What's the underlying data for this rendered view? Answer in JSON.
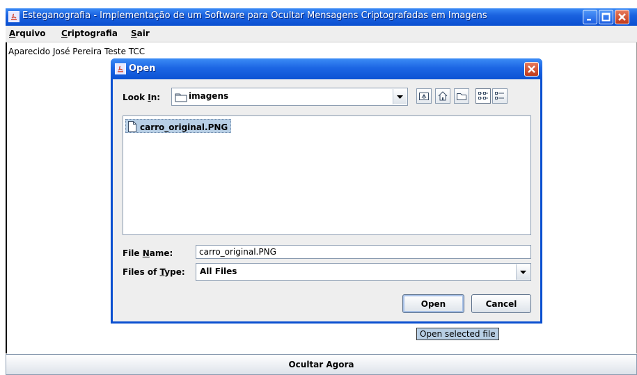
{
  "window": {
    "title": "Esteganografia - Implementação de um Software para Ocultar Mensagens Criptografadas em Imagens"
  },
  "menu": {
    "items": [
      {
        "label": "Arquivo",
        "mnemonic": "A",
        "rest": "rquivo"
      },
      {
        "label": "Criptografia",
        "mnemonic": "C",
        "rest": "riptografia"
      },
      {
        "label": "Sair",
        "mnemonic": "S",
        "rest": "air"
      }
    ]
  },
  "content": {
    "author_label": "Aparecido José Pereira Teste TCC"
  },
  "bottom_button": {
    "label": "Ocultar Agora"
  },
  "dialog": {
    "title": "Open",
    "look_in": {
      "label_pre": "Look ",
      "label_mnemonic": "I",
      "label_post": "n:",
      "value": "imagens"
    },
    "toolbar_icons": [
      "up-folder-icon",
      "home-icon",
      "new-folder-icon",
      "list-view-icon",
      "details-view-icon"
    ],
    "files": [
      {
        "name": "carro_original.PNG",
        "selected": true
      }
    ],
    "file_name": {
      "label_pre": "File ",
      "label_mnemonic": "N",
      "label_post": "ame:",
      "value": "carro_original.PNG"
    },
    "files_of_type": {
      "label_pre": "Files of ",
      "label_mnemonic": "T",
      "label_post": "ype:",
      "value": "All Files"
    },
    "open_button": "Open",
    "cancel_button": "Cancel"
  },
  "tooltip": {
    "text": "Open selected file"
  },
  "colors": {
    "title_bar": "#1a62e0",
    "selection": "#b8cfe5",
    "panel": "#eeeeee"
  }
}
